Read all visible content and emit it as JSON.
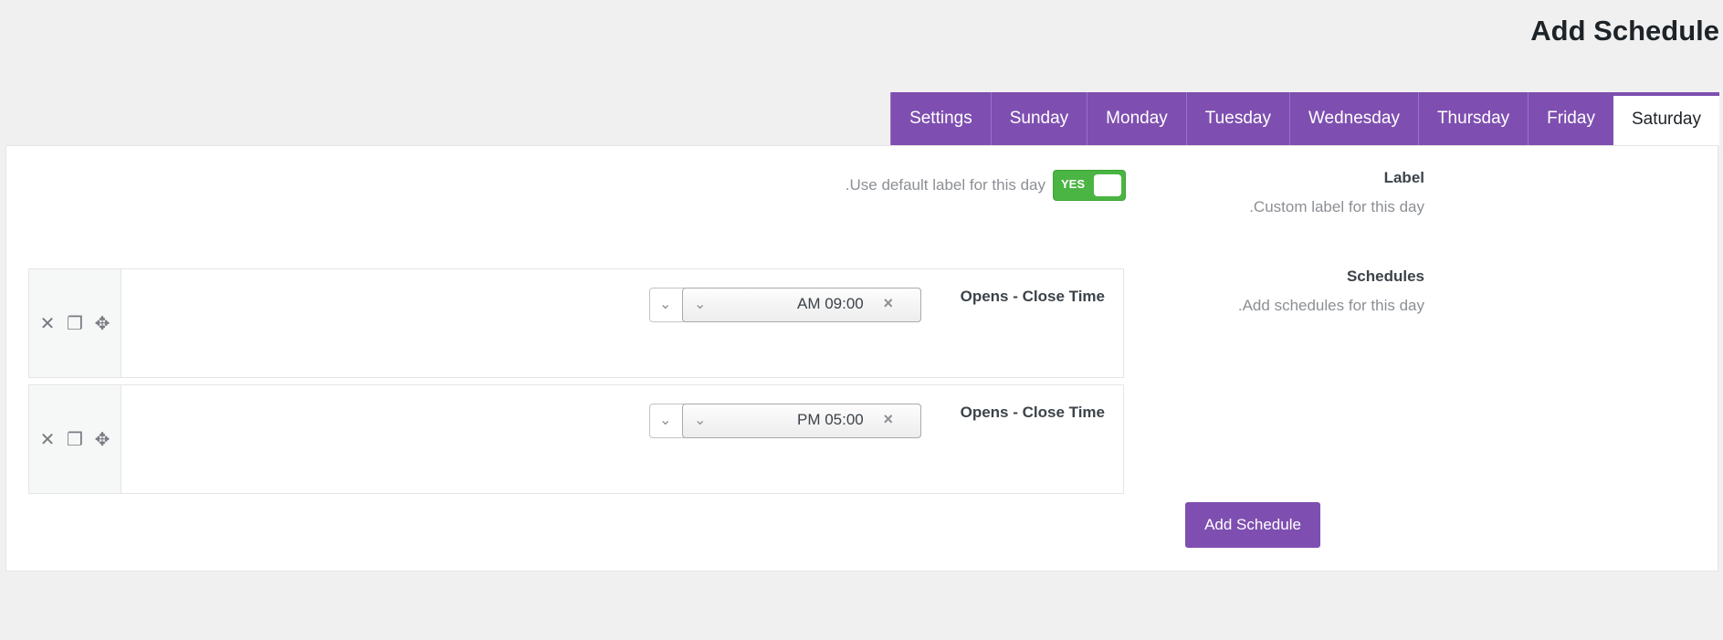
{
  "page": {
    "title": "Add Schedule"
  },
  "tabs": [
    {
      "label": "Saturday",
      "active": true
    },
    {
      "label": "Friday"
    },
    {
      "label": "Thursday"
    },
    {
      "label": "Wednesday"
    },
    {
      "label": "Tuesday"
    },
    {
      "label": "Monday"
    },
    {
      "label": "Sunday"
    },
    {
      "label": "Settings"
    }
  ],
  "label_field": {
    "heading": "Label",
    "description": ".Custom label for this day",
    "toggle_text": ".Use default label for this day",
    "toggle_state": "YES"
  },
  "schedules_field": {
    "heading": "Schedules",
    "description": ".Add schedules for this day"
  },
  "rows": [
    {
      "label": "Opens - Close Time",
      "value": "AM 09:00"
    },
    {
      "label": "Opens - Close Time",
      "value": "PM 05:00"
    }
  ],
  "icons": {
    "remove": "close-icon",
    "duplicate": "copy-icon",
    "move": "move-icon",
    "dropdown": "chevron-down-icon",
    "clear": "clear-icon"
  },
  "add_button": "Add Schedule",
  "colors": {
    "accent": "#7e4fb0",
    "toggle_on": "#4bb543"
  }
}
